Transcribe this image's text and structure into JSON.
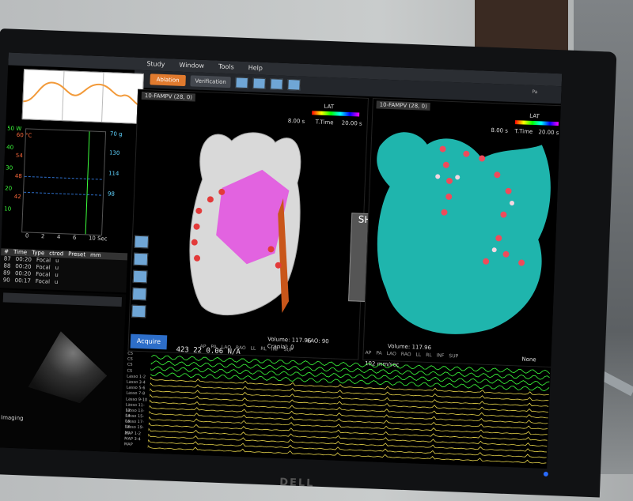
{
  "menu": {
    "items": [
      "Study",
      "Window",
      "Tools",
      "Help"
    ]
  },
  "toolbar": {
    "primary_label": "Ablation",
    "secondary_label": "Verification",
    "timestamp": "Pa"
  },
  "vitals": {
    "left_scale_top": "50 W",
    "left_scale_temp": "60 °C",
    "left_ticks": [
      "40",
      "30",
      "20",
      "10"
    ],
    "temp_ticks": [
      "54",
      "48",
      "42",
      "36",
      "30"
    ],
    "right_scale_top": "70 g",
    "right_ticks": [
      "130",
      "114",
      "98",
      "82",
      "70"
    ],
    "right_bottom": "10 Sec",
    "x_ticks": [
      "0",
      "2",
      "4",
      "6",
      "8"
    ]
  },
  "events": {
    "headers": [
      "#",
      "Time",
      "Type",
      "ctrod",
      "Preset",
      "mm"
    ],
    "rows": [
      [
        "87",
        "00:20",
        "Focal",
        "",
        "u"
      ],
      [
        "88",
        "00:20",
        "Focal",
        "",
        "u"
      ],
      [
        "89",
        "00:20",
        "Focal",
        "",
        "u"
      ],
      [
        "90",
        "00:17",
        "Focal",
        "",
        "u"
      ]
    ]
  },
  "ultrasound": {
    "label": "Imaging"
  },
  "view1": {
    "title": "10-FAMPV (28, 0)",
    "lat_label": "LAT",
    "lat_min": "8.00 s",
    "lat_max": "20.00 s",
    "time_label": "T.Time",
    "sh_label": "SH",
    "volume": "Volume: 117.96",
    "lao": "LAO: 90",
    "cranial": "Cranial: 0",
    "counter": "423  22  0.06  N/A",
    "acquire": "Acquire",
    "footer": [
      "AP",
      "PA",
      "LAO",
      "RAO",
      "LL",
      "RL",
      "INF",
      "SUP"
    ]
  },
  "view2": {
    "title": "10-FAMPV (28, 0)",
    "lat_label": "LAT",
    "lat_min": "8.00 s",
    "lat_max": "20.00 s",
    "time_label": "T.Time",
    "volume": "Volume: 117.96",
    "footer": [
      "AP",
      "PA",
      "LAO",
      "RAO",
      "LL",
      "RL",
      "INF",
      "SUP"
    ],
    "none_label": "None"
  },
  "ecg": {
    "labels": [
      "CS",
      "CS",
      "CS",
      "CS",
      "Lasso 1-2",
      "Lasso 3-4",
      "Lasso 5-6",
      "Lasso 7-8",
      "Lasso 9-10",
      "Lasso 11-12",
      "Lasso 13-14",
      "Lasso 15-16",
      "Lasso 17-18",
      "Lasso 19-20",
      "MAP 1-2",
      "MAP 3-4",
      "MAP"
    ],
    "speed": "102 mm/sec"
  },
  "monitor_brand": "DELL",
  "colors": {
    "accent": "#e07a2e",
    "mesh_cyan": "#1fb5ad",
    "mesh_magenta": "#e040d8",
    "ecg_green": "#3cff3c",
    "ecg_yellow": "#e6d34a"
  }
}
